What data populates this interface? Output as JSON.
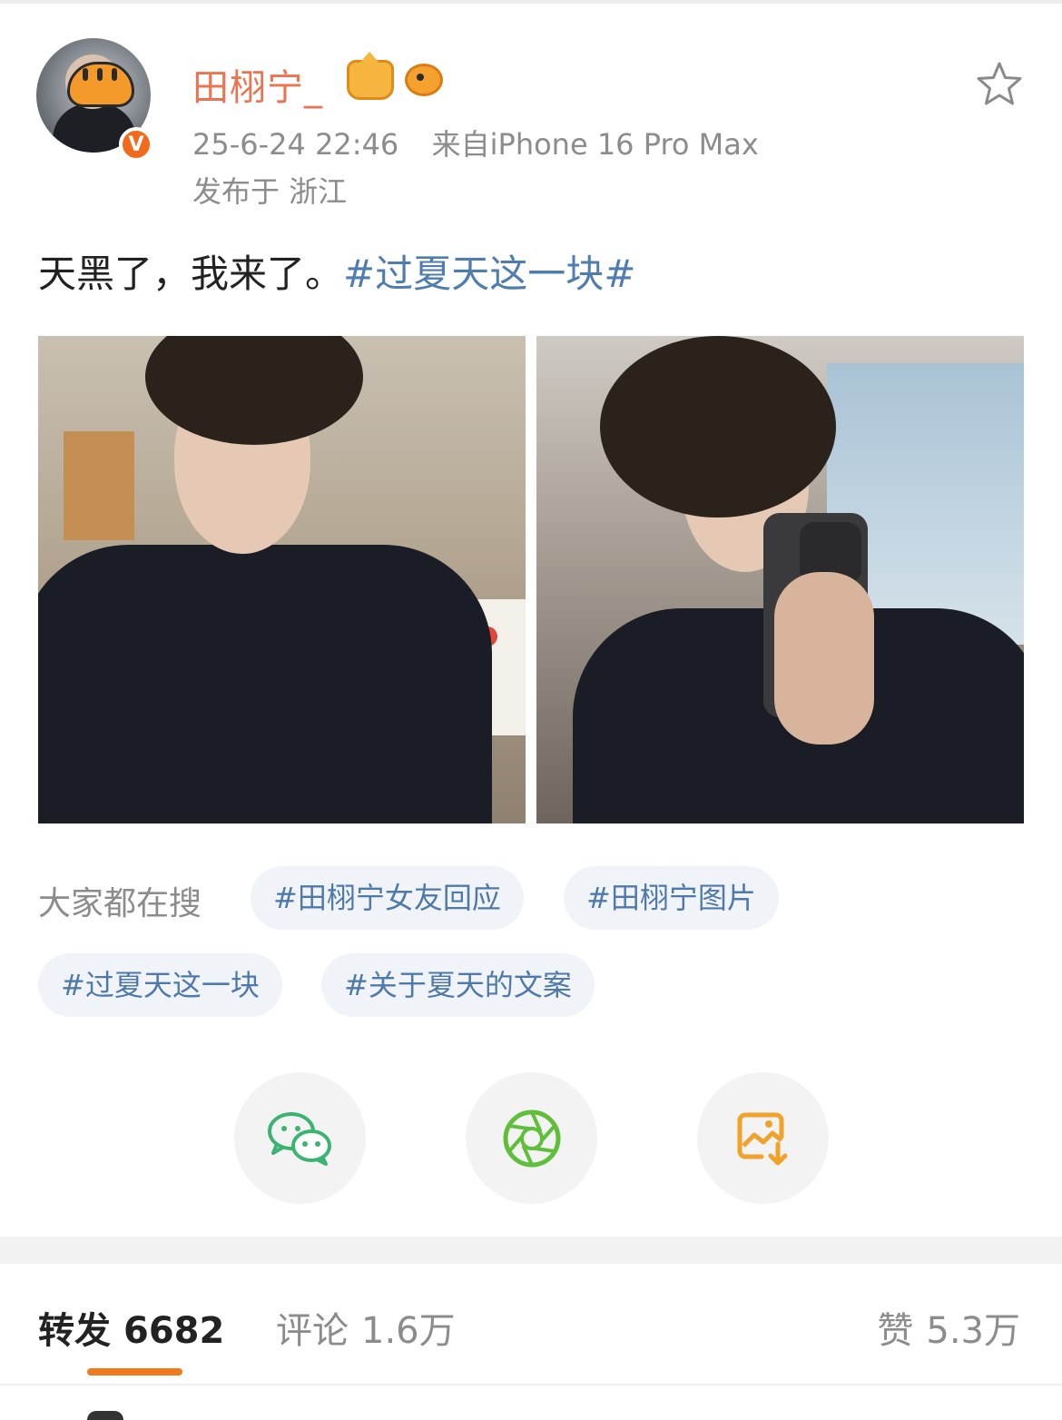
{
  "post": {
    "username": "田栩宁_",
    "timestamp": "25-6-24 22:46",
    "source": "来自iPhone 16 Pro Max",
    "location": "发布于 浙江",
    "text": "天黑了，我来了。",
    "hashtag": "#过夏天这一块#",
    "verified_badge": "V",
    "icons": [
      "crown-badge-icon",
      "pufferfish-badge-icon",
      "star-icon"
    ]
  },
  "hot_search": {
    "label": "大家都在搜",
    "tags": [
      "#田栩宁女友回应",
      "#田栩宁图片",
      "#过夏天这一块",
      "#关于夏天的文案"
    ]
  },
  "share": {
    "icons": [
      "wechat-icon",
      "moments-icon",
      "save-image-icon"
    ],
    "colors": {
      "wechat": "#3cb371",
      "moments": "#5fbf3a",
      "save": "#f1a22b"
    }
  },
  "tabs": {
    "repost_label": "转发",
    "repost_count": "6682",
    "comment_label": "评论",
    "comment_count": "1.6万",
    "like_label": "赞",
    "like_count": "5.3万"
  },
  "colors": {
    "username": "#eb7350",
    "link": "#507daf",
    "accent": "#f17a1c"
  }
}
